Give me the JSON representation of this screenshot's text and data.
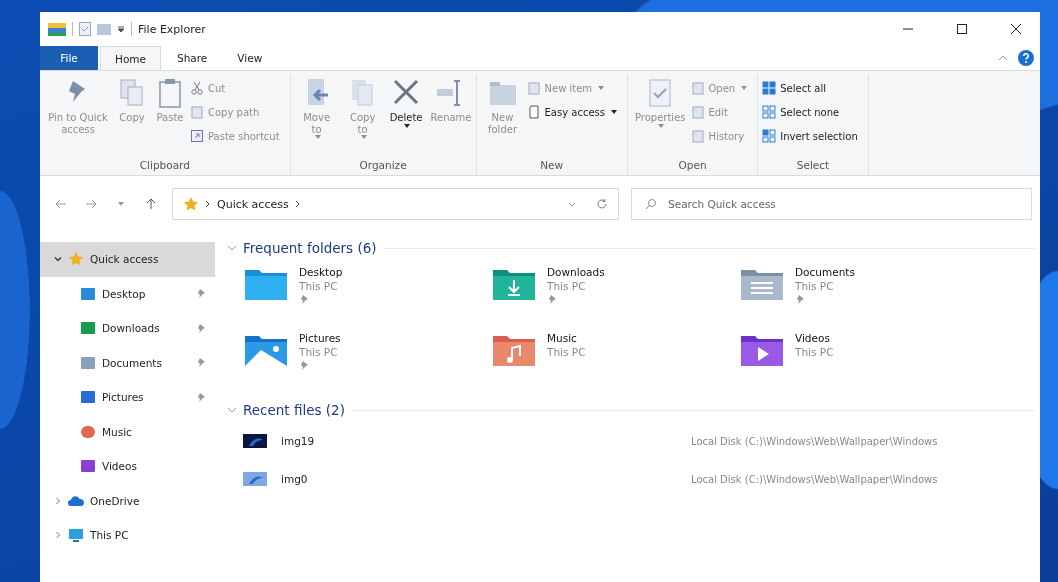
{
  "window": {
    "title": "File Explorer"
  },
  "ribbon_tabs": [
    {
      "label": "File",
      "kind": "file",
      "selected": false
    },
    {
      "label": "Home",
      "kind": "tab",
      "selected": true
    },
    {
      "label": "Share",
      "kind": "tab",
      "selected": false
    },
    {
      "label": "View",
      "kind": "tab",
      "selected": false
    }
  ],
  "ribbon_groups": [
    {
      "label": "Clipboard",
      "large": [
        {
          "label": "Pin to Quick access",
          "disabled": true,
          "dropdown": false
        },
        {
          "label": "Copy",
          "disabled": true,
          "dropdown": false
        },
        {
          "label": "Paste",
          "disabled": true,
          "dropdown": false
        }
      ],
      "small": [
        {
          "label": "Cut",
          "disabled": true,
          "dropdown": false
        },
        {
          "label": "Copy path",
          "disabled": true,
          "dropdown": false
        },
        {
          "label": "Paste shortcut",
          "disabled": true,
          "dropdown": false
        }
      ]
    },
    {
      "label": "Organize",
      "large": [
        {
          "label": "Move to",
          "disabled": true,
          "dropdown": true
        },
        {
          "label": "Copy to",
          "disabled": true,
          "dropdown": true
        },
        {
          "label": "Delete",
          "disabled": false,
          "dropdown": true
        },
        {
          "label": "Rename",
          "disabled": true,
          "dropdown": false
        }
      ]
    },
    {
      "label": "New",
      "large": [
        {
          "label": "New folder",
          "disabled": true,
          "dropdown": false
        }
      ],
      "small": [
        {
          "label": "New item",
          "disabled": true,
          "dropdown": true
        },
        {
          "label": "Easy access",
          "disabled": false,
          "dropdown": true
        }
      ]
    },
    {
      "label": "Open",
      "large": [
        {
          "label": "Properties",
          "disabled": true,
          "dropdown": true
        }
      ],
      "small": [
        {
          "label": "Open",
          "disabled": true,
          "dropdown": true
        },
        {
          "label": "Edit",
          "disabled": true,
          "dropdown": false
        },
        {
          "label": "History",
          "disabled": true,
          "dropdown": false
        }
      ]
    },
    {
      "label": "Select",
      "small": [
        {
          "label": "Select all",
          "disabled": false,
          "dropdown": false
        },
        {
          "label": "Select none",
          "disabled": false,
          "dropdown": false
        },
        {
          "label": "Invert selection",
          "disabled": false,
          "dropdown": false
        }
      ]
    }
  ],
  "address_bar": {
    "path": [
      "Quick access"
    ]
  },
  "search": {
    "placeholder": "Search Quick access"
  },
  "sidebar": {
    "items": [
      {
        "label": "Quick access",
        "expanded": true,
        "selected": true,
        "children": [
          {
            "label": "Desktop",
            "pinned": true,
            "selected": false
          },
          {
            "label": "Downloads",
            "pinned": true,
            "selected": false
          },
          {
            "label": "Documents",
            "pinned": true,
            "selected": false
          },
          {
            "label": "Pictures",
            "pinned": true,
            "selected": false
          },
          {
            "label": "Music",
            "pinned": false,
            "selected": false
          },
          {
            "label": "Videos",
            "pinned": false,
            "selected": false
          }
        ]
      },
      {
        "label": "OneDrive",
        "expanded": false,
        "selected": false
      },
      {
        "label": "This PC",
        "expanded": false,
        "selected": false
      }
    ]
  },
  "frequent_folders": {
    "title": "Frequent folders (6)",
    "expanded": true,
    "items": [
      {
        "name": "Desktop",
        "location": "This PC",
        "pinned": true
      },
      {
        "name": "Downloads",
        "location": "This PC",
        "pinned": true
      },
      {
        "name": "Documents",
        "location": "This PC",
        "pinned": true
      },
      {
        "name": "Pictures",
        "location": "This PC",
        "pinned": true
      },
      {
        "name": "Music",
        "location": "This PC",
        "pinned": false
      },
      {
        "name": "Videos",
        "location": "This PC",
        "pinned": false
      }
    ]
  },
  "recent_files": {
    "title": "Recent files (2)",
    "expanded": true,
    "items": [
      {
        "name": "img19",
        "path": "Local Disk (C:)\\Windows\\Web\\Wallpaper\\Windows"
      },
      {
        "name": "img0",
        "path": "Local Disk (C:)\\Windows\\Web\\Wallpaper\\Windows"
      }
    ]
  }
}
